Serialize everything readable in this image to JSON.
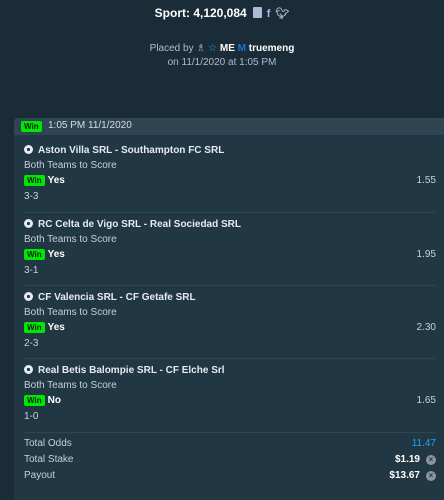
{
  "header": {
    "sport_label": "Sport: 4,120,084",
    "placed_by": "Placed by",
    "user_prefix": "ME",
    "user_badge": "M",
    "username": "truemeng",
    "placed_on": "on 11/1/2020 at 1:05 PM"
  },
  "slip": {
    "status": "Win",
    "timestamp": "1:05 PM 11/1/2020",
    "bets": [
      {
        "match": "Aston Villa SRL - Southampton FC SRL",
        "market": "Both Teams to Score",
        "result": "Win",
        "pick": "Yes",
        "score": "3-3",
        "odds": "1.55"
      },
      {
        "match": "RC Celta de Vigo SRL - Real Sociedad SRL",
        "market": "Both Teams to Score",
        "result": "Win",
        "pick": "Yes",
        "score": "3-1",
        "odds": "1.95"
      },
      {
        "match": "CF Valencia SRL - CF Getafe SRL",
        "market": "Both Teams to Score",
        "result": "Win",
        "pick": "Yes",
        "score": "2-3",
        "odds": "2.30"
      },
      {
        "match": "Real Betis Balompie SRL - CF Elche Srl",
        "market": "Both Teams to Score",
        "result": "Win",
        "pick": "No",
        "score": "1-0",
        "odds": "1.65"
      }
    ],
    "summary": {
      "total_odds_label": "Total Odds",
      "total_odds": "11.47",
      "total_stake_label": "Total Stake",
      "total_stake": "$1.19",
      "payout_label": "Payout",
      "payout": "$13.67"
    }
  },
  "colors": {
    "background": "#1a2c38",
    "card": "#213743",
    "win_green": "#00e701",
    "accent_blue": "#1fa3ff"
  },
  "icons": [
    "copy-icon",
    "facebook-icon",
    "twitter-icon",
    "vip-icon",
    "star-icon",
    "soccer-ball-icon",
    "coin-icon"
  ]
}
